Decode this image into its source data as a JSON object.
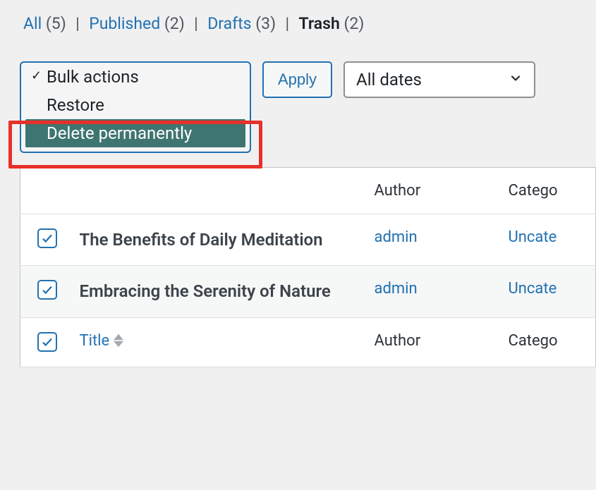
{
  "filters": {
    "all": {
      "label": "All",
      "count": "(5)"
    },
    "published": {
      "label": "Published",
      "count": "(2)"
    },
    "drafts": {
      "label": "Drafts",
      "count": "(3)"
    },
    "trash": {
      "label": "Trash",
      "count": "(2)"
    }
  },
  "bulk": {
    "option_default": "Bulk actions",
    "option_restore": "Restore",
    "option_delete": "Delete permanently"
  },
  "apply_label": "Apply",
  "date_filter": {
    "selected": "All dates"
  },
  "columns": {
    "title": "Title",
    "author": "Author",
    "categories": "Catego"
  },
  "rows": [
    {
      "title": "The Benefits of Daily Meditation",
      "author": "admin",
      "category": "Uncate",
      "checked": true
    },
    {
      "title": "Embracing the Serenity of Nature",
      "author": "admin",
      "category": "Uncate",
      "checked": true
    }
  ],
  "footer": {
    "title": "Title",
    "author": "Author",
    "categories": "Catego"
  }
}
